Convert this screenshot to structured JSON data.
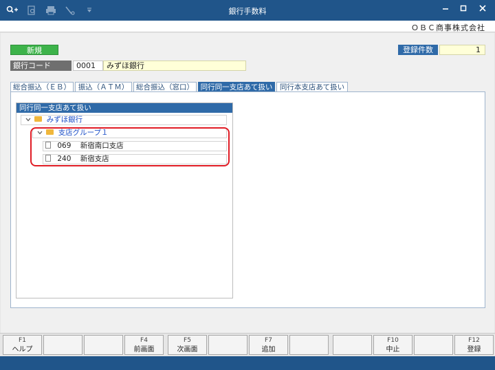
{
  "window": {
    "title": "銀行手数料",
    "company": "ＯＢＣ商事株式会社",
    "toolbar_icons": [
      "search-plus-icon",
      "search-doc-icon",
      "print-icon",
      "tools-icon",
      "dropdown-icon"
    ],
    "controls": [
      "minimize-icon",
      "maximize-icon",
      "close-icon"
    ]
  },
  "status": {
    "mode": "新規",
    "registered_label": "登録件数",
    "registered_count": "1"
  },
  "bank": {
    "label": "銀行コード",
    "code": "0001",
    "name": "みずほ銀行"
  },
  "tabs": [
    {
      "label": "総合振込（ＥＢ）",
      "active": false
    },
    {
      "label": "振込（ＡＴＭ）",
      "active": false
    },
    {
      "label": "総合振込（窓口）",
      "active": false
    },
    {
      "label": "同行同一支店あて扱い",
      "active": true
    },
    {
      "label": "同行本支店あて扱い",
      "active": false
    }
  ],
  "tree": {
    "header": "同行同一支店あて扱い",
    "root": "みずほ銀行",
    "group": "支店グループ１",
    "branches": [
      {
        "code": "069",
        "name": "新宿南口支店"
      },
      {
        "code": "240",
        "name": "新宿支店"
      }
    ]
  },
  "fkeys": [
    {
      "key": "F1",
      "label": "ヘルプ"
    },
    {
      "key": "",
      "label": ""
    },
    {
      "key": "",
      "label": ""
    },
    {
      "key": "F4",
      "label": "前画面"
    },
    {
      "key": "F5",
      "label": "次画面"
    },
    {
      "key": "",
      "label": ""
    },
    {
      "key": "F7",
      "label": "追加"
    },
    {
      "key": "",
      "label": ""
    },
    {
      "key": "",
      "label": ""
    },
    {
      "key": "F10",
      "label": "中止"
    },
    {
      "key": "",
      "label": ""
    },
    {
      "key": "F12",
      "label": "登録"
    }
  ],
  "colors": {
    "titlebar": "#20558a",
    "accent": "#2f6aa8",
    "new_badge": "#3db34a",
    "highlight": "#e01b24"
  }
}
